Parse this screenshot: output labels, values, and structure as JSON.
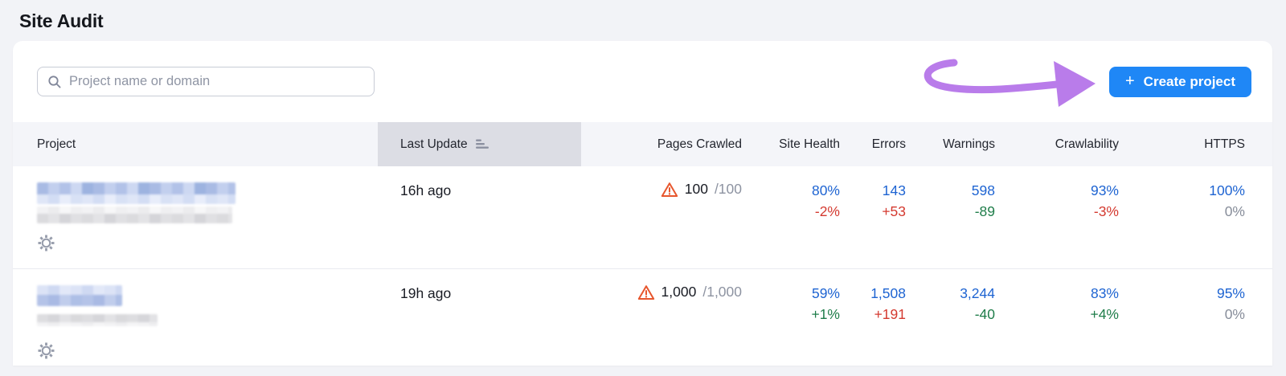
{
  "page_title": "Site Audit",
  "toolbar": {
    "search_placeholder": "Project name or domain",
    "plus": "+",
    "create_project_label": "Create project"
  },
  "table": {
    "columns": [
      "Project",
      "Last Update",
      "Pages Crawled",
      "Site Health",
      "Errors",
      "Warnings",
      "Crawlability",
      "HTTPS"
    ],
    "rows": [
      {
        "last_update": "16h ago",
        "pages_crawled": {
          "crawled": "100",
          "total": "/100"
        },
        "site_health": {
          "value": "80%",
          "delta": "-2%",
          "tone": "red"
        },
        "errors": {
          "value": "143",
          "delta": "+53",
          "tone": "red"
        },
        "warnings": {
          "value": "598",
          "delta": "-89",
          "tone": "green"
        },
        "crawlability": {
          "value": "93%",
          "delta": "-3%",
          "tone": "red"
        },
        "https": {
          "value": "100%",
          "delta": "0%",
          "tone": "gray"
        }
      },
      {
        "last_update": "19h ago",
        "pages_crawled": {
          "crawled": "1,000",
          "total": "/1,000"
        },
        "site_health": {
          "value": "59%",
          "delta": "+1%",
          "tone": "green"
        },
        "errors": {
          "value": "1,508",
          "delta": "+191",
          "tone": "red"
        },
        "warnings": {
          "value": "3,244",
          "delta": "-40",
          "tone": "green"
        },
        "crawlability": {
          "value": "83%",
          "delta": "+4%",
          "tone": "green"
        },
        "https": {
          "value": "95%",
          "delta": "0%",
          "tone": "gray"
        }
      }
    ]
  },
  "icons": {
    "search": "magnifier",
    "sort": "sort-bars",
    "warning": "triangle-exclamation",
    "settings": "gear",
    "create": "plus",
    "annotation": "purple-curved-arrow-pointing-right"
  },
  "colors": {
    "button_blue": "#1f87f6",
    "value_blue": "#1e64d2",
    "delta_red": "#d43a30",
    "delta_green": "#1f7d4a",
    "delta_gray": "#878d9a",
    "warning_orange": "#e7562d",
    "arrow_purple": "#b97cea",
    "header_bg": "#f4f5f9",
    "sorted_column_bg": "#dcdde4",
    "page_bg": "#f2f3f7"
  }
}
